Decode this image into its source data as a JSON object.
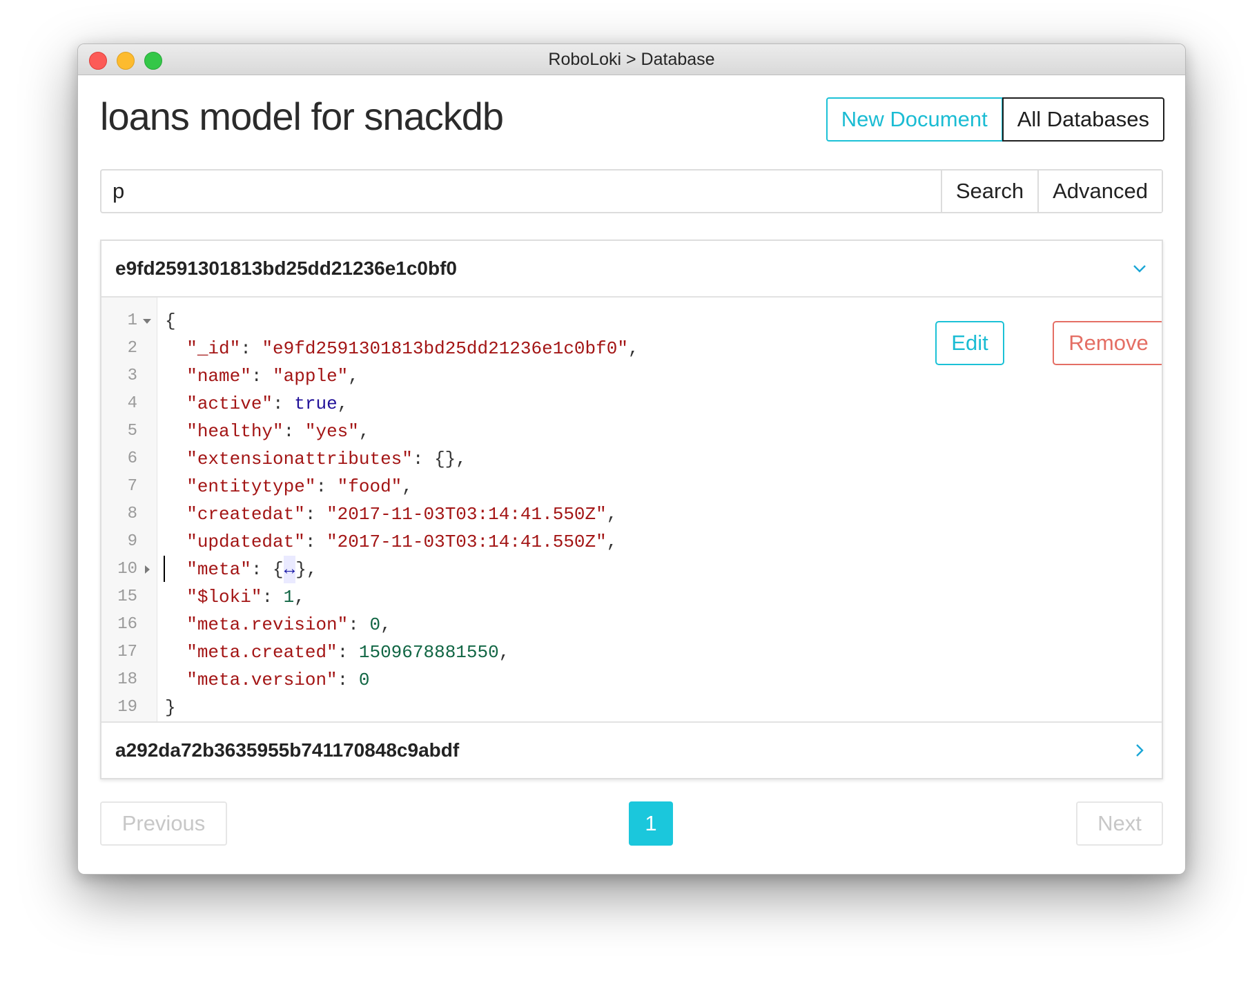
{
  "window": {
    "title": "RoboLoki > Database"
  },
  "header": {
    "title": "loans model for snackdb",
    "new_document_label": "New Document",
    "all_databases_label": "All Databases"
  },
  "search": {
    "value": "p",
    "search_label": "Search",
    "advanced_label": "Advanced"
  },
  "documents": [
    {
      "id": "e9fd2591301813bd25dd21236e1c0bf0",
      "expanded": true
    },
    {
      "id": "a292da72b3635955b741170848c9abdf",
      "expanded": false
    }
  ],
  "editor": {
    "edit_label": "Edit",
    "remove_label": "Remove",
    "lines": [
      {
        "num": "1",
        "parts": [
          [
            "p",
            "{"
          ]
        ]
      },
      {
        "num": "2",
        "parts": [
          [
            "p",
            "  "
          ],
          [
            "k",
            "\"_id\""
          ],
          [
            "p",
            ": "
          ],
          [
            "s",
            "\"e9fd2591301813bd25dd21236e1c0bf0\""
          ],
          [
            "p",
            ","
          ]
        ]
      },
      {
        "num": "3",
        "parts": [
          [
            "p",
            "  "
          ],
          [
            "k",
            "\"name\""
          ],
          [
            "p",
            ": "
          ],
          [
            "s",
            "\"apple\""
          ],
          [
            "p",
            ","
          ]
        ]
      },
      {
        "num": "4",
        "parts": [
          [
            "p",
            "  "
          ],
          [
            "k",
            "\"active\""
          ],
          [
            "p",
            ": "
          ],
          [
            "b",
            "true"
          ],
          [
            "p",
            ","
          ]
        ]
      },
      {
        "num": "5",
        "parts": [
          [
            "p",
            "  "
          ],
          [
            "k",
            "\"healthy\""
          ],
          [
            "p",
            ": "
          ],
          [
            "s",
            "\"yes\""
          ],
          [
            "p",
            ","
          ]
        ]
      },
      {
        "num": "6",
        "parts": [
          [
            "p",
            "  "
          ],
          [
            "k",
            "\"extensionattributes\""
          ],
          [
            "p",
            ": {},"
          ]
        ]
      },
      {
        "num": "7",
        "parts": [
          [
            "p",
            "  "
          ],
          [
            "k",
            "\"entitytype\""
          ],
          [
            "p",
            ": "
          ],
          [
            "s",
            "\"food\""
          ],
          [
            "p",
            ","
          ]
        ]
      },
      {
        "num": "8",
        "parts": [
          [
            "p",
            "  "
          ],
          [
            "k",
            "\"createdat\""
          ],
          [
            "p",
            ": "
          ],
          [
            "s",
            "\"2017-11-03T03:14:41.550Z\""
          ],
          [
            "p",
            ","
          ]
        ]
      },
      {
        "num": "9",
        "parts": [
          [
            "p",
            "  "
          ],
          [
            "k",
            "\"updatedat\""
          ],
          [
            "p",
            ": "
          ],
          [
            "s",
            "\"2017-11-03T03:14:41.550Z\""
          ],
          [
            "p",
            ","
          ]
        ]
      },
      {
        "num": "10",
        "parts": [
          [
            "p",
            "  "
          ],
          [
            "k",
            "\"meta\""
          ],
          [
            "p",
            ": {"
          ],
          [
            "e",
            "↔"
          ],
          [
            "p",
            "},"
          ]
        ]
      },
      {
        "num": "15",
        "parts": [
          [
            "p",
            "  "
          ],
          [
            "k",
            "\"$loki\""
          ],
          [
            "p",
            ": "
          ],
          [
            "n",
            "1"
          ],
          [
            "p",
            ","
          ]
        ]
      },
      {
        "num": "16",
        "parts": [
          [
            "p",
            "  "
          ],
          [
            "k",
            "\"meta.revision\""
          ],
          [
            "p",
            ": "
          ],
          [
            "n",
            "0"
          ],
          [
            "p",
            ","
          ]
        ]
      },
      {
        "num": "17",
        "parts": [
          [
            "p",
            "  "
          ],
          [
            "k",
            "\"meta.created\""
          ],
          [
            "p",
            ": "
          ],
          [
            "n",
            "1509678881550"
          ],
          [
            "p",
            ","
          ]
        ]
      },
      {
        "num": "18",
        "parts": [
          [
            "p",
            "  "
          ],
          [
            "k",
            "\"meta.version\""
          ],
          [
            "p",
            ": "
          ],
          [
            "n",
            "0"
          ]
        ]
      },
      {
        "num": "19",
        "parts": [
          [
            "p",
            "}"
          ]
        ]
      }
    ],
    "fold_open_line": "1",
    "fold_closed_line": "10",
    "cursor_line": "10"
  },
  "pagination": {
    "previous_label": "Previous",
    "next_label": "Next",
    "current_page": "1"
  },
  "colors": {
    "accent": "#1bc1d6",
    "danger": "#e46e64",
    "string": "#a31515",
    "number": "#116644",
    "boolean": "#221199"
  }
}
